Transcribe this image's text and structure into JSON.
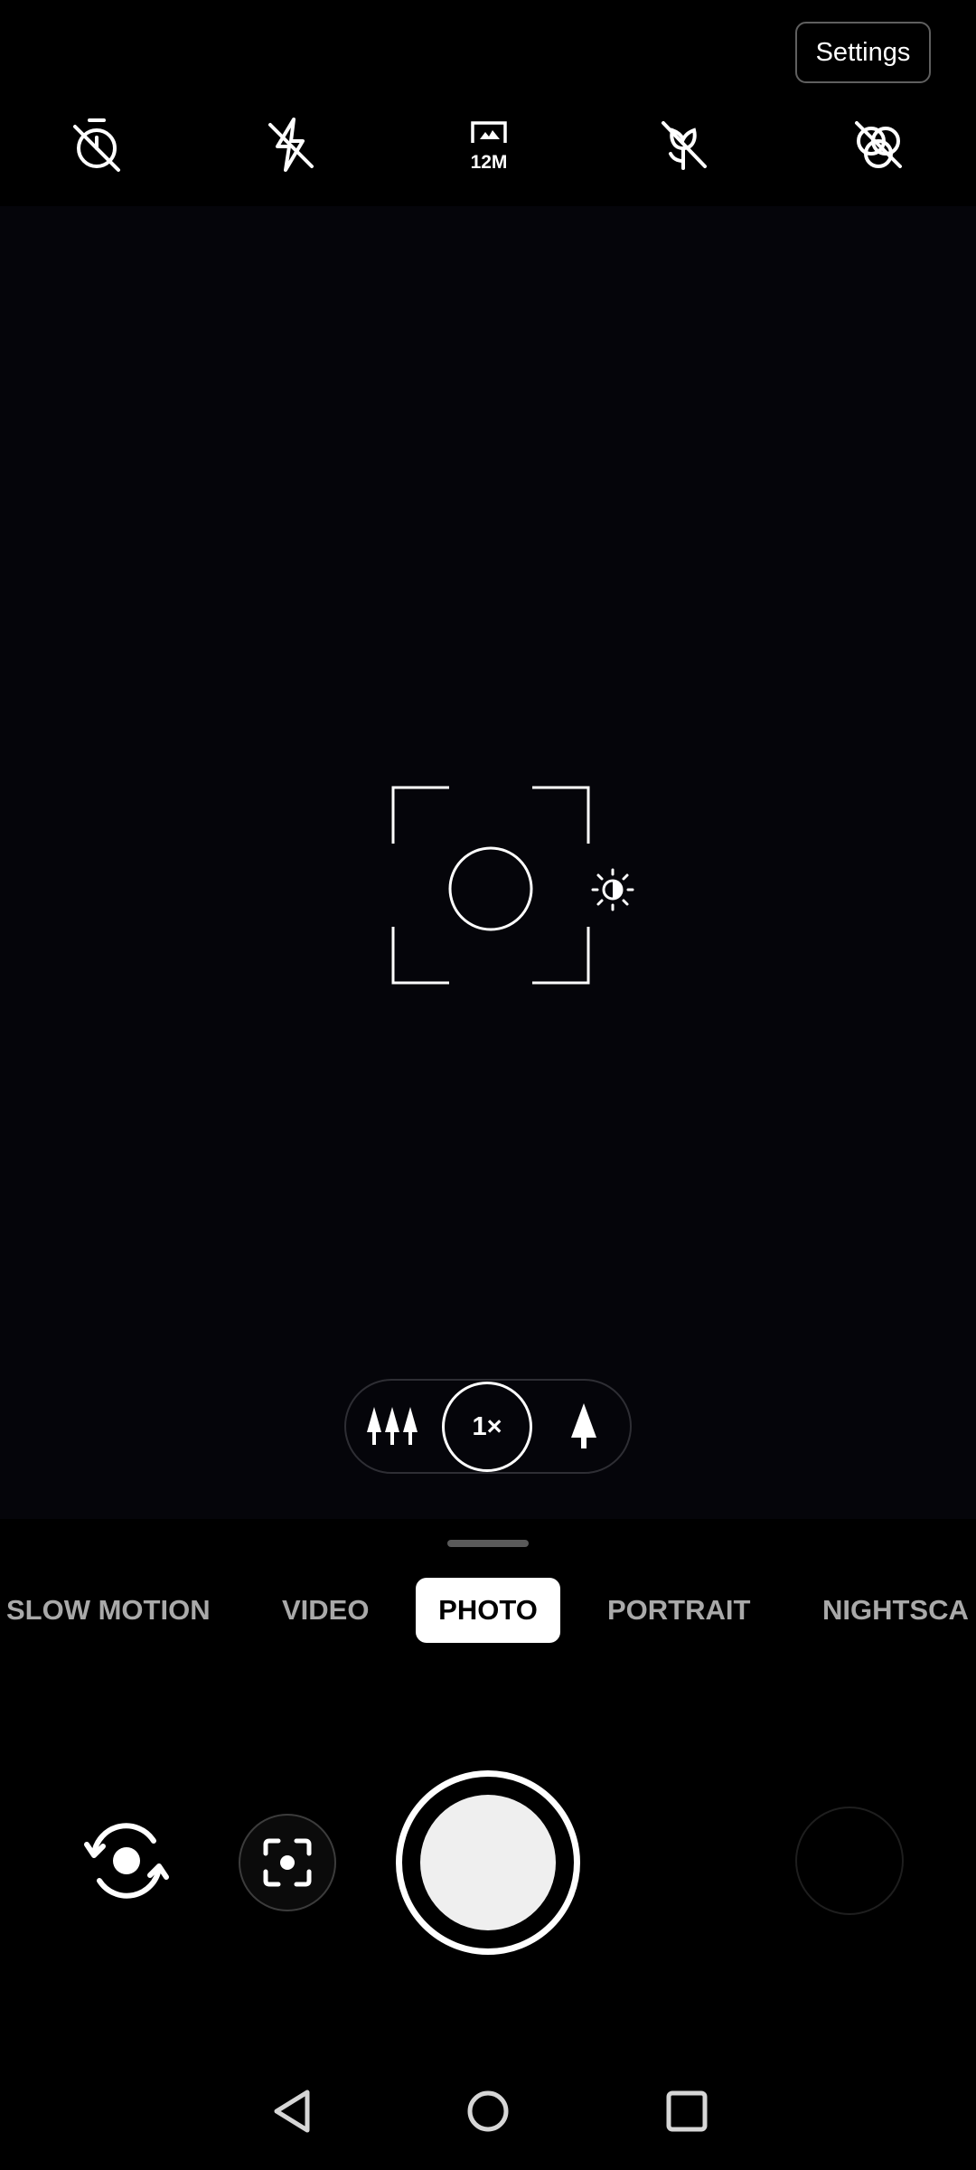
{
  "header": {
    "settings_label": "Settings"
  },
  "top_controls": [
    {
      "name": "timer-off-icon",
      "label": ""
    },
    {
      "name": "flash-off-icon",
      "label": ""
    },
    {
      "name": "resolution-icon",
      "label": "12M"
    },
    {
      "name": "macro-off-icon",
      "label": ""
    },
    {
      "name": "filter-off-icon",
      "label": ""
    }
  ],
  "zoom": {
    "current": "1×",
    "options": [
      "wide-angle",
      "1×",
      "telephoto"
    ]
  },
  "modes": {
    "items": [
      "SLOW MOTION",
      "VIDEO",
      "PHOTO",
      "PORTRAIT",
      "NIGHTSCA"
    ],
    "selected": "PHOTO"
  },
  "bottom_controls": {
    "icons": [
      "camera-flip-icon",
      "lens-scan-icon",
      "shutter-button",
      "gallery-thumbnail"
    ]
  },
  "navigation": {
    "icons": [
      "back-icon",
      "home-icon",
      "recents-icon"
    ]
  },
  "colors": {
    "background": "#000000",
    "viewfinder": "#05050a",
    "mode_inactive": "#a9a9a9",
    "mode_active_bg": "#ffffff",
    "mode_active_text": "#000000"
  }
}
